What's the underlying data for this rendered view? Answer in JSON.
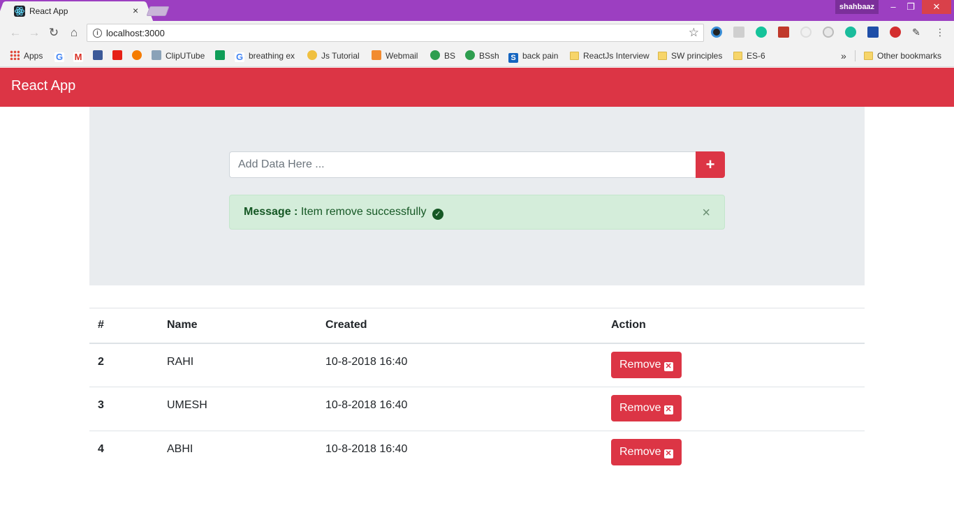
{
  "browser": {
    "tab_title": "React App",
    "tab_close": "×",
    "user": "shahbaaz",
    "url": "localhost:3000",
    "window_controls": {
      "minimize": "–",
      "restore": "❐",
      "close": "✕"
    },
    "nav": {
      "back": "←",
      "forward": "→",
      "reload": "↻",
      "home": "⌂"
    },
    "bookmarks": [
      {
        "label": "Apps",
        "icon": "apps-grid-icon"
      },
      {
        "label": "",
        "icon": "google-icon"
      },
      {
        "label": "",
        "icon": "gmail-icon"
      },
      {
        "label": "",
        "icon": "facebook-icon"
      },
      {
        "label": "",
        "icon": "youtube-icon"
      },
      {
        "label": "",
        "icon": "orange-circle-icon"
      },
      {
        "label": "ClipUTube",
        "icon": "clip-icon"
      },
      {
        "label": "",
        "icon": "sheets-icon"
      },
      {
        "label": "breathing ex",
        "icon": "google-icon"
      },
      {
        "label": "Js Tutorial",
        "icon": "magnifier-icon"
      },
      {
        "label": "Webmail",
        "icon": "webmail-icon"
      },
      {
        "label": "BS",
        "icon": "bs-icon"
      },
      {
        "label": "BSsh",
        "icon": "bs-icon"
      },
      {
        "label": "back pain",
        "icon": "s-icon"
      },
      {
        "label": "ReactJs Interview",
        "icon": "folder-icon"
      },
      {
        "label": "SW principles",
        "icon": "folder-icon"
      },
      {
        "label": "ES-6",
        "icon": "folder-icon"
      }
    ],
    "bookmarks_overflow": "»",
    "other_bookmarks": "Other bookmarks"
  },
  "app": {
    "title": "React App",
    "input": {
      "placeholder": "Add Data Here ...",
      "value": ""
    },
    "add_button": "+",
    "alert": {
      "label": "Message :",
      "text": "Item remove successfully",
      "close": "×"
    },
    "table": {
      "headers": [
        "#",
        "Name",
        "Created",
        "Action"
      ],
      "rows": [
        {
          "id": "2",
          "name": "RAHI",
          "created": "10-8-2018 16:40",
          "action": "Remove"
        },
        {
          "id": "3",
          "name": "UMESH",
          "created": "10-8-2018 16:40",
          "action": "Remove"
        },
        {
          "id": "4",
          "name": "ABHI",
          "created": "10-8-2018 16:40",
          "action": "Remove"
        }
      ]
    }
  },
  "colors": {
    "titlebar": "#9c3fc1",
    "accent": "#dc3545",
    "alert_bg": "#d4edda",
    "alert_text": "#155724",
    "jumbotron": "#e9ecef"
  }
}
